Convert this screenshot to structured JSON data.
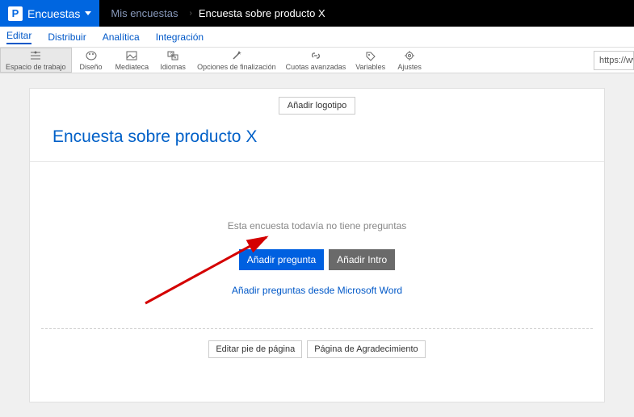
{
  "top": {
    "brand_letter": "P",
    "brand_label": "Encuestas",
    "my_surveys": "Mis encuestas",
    "breadcrumb_current": "Encuesta sobre producto X"
  },
  "subnav": {
    "edit": "Editar",
    "distribute": "Distribuir",
    "analytics": "Analítica",
    "integration": "Integración"
  },
  "toolbar": {
    "workspace": "Espacio de trabajo",
    "design": "Diseño",
    "media": "Mediateca",
    "languages": "Idiomas",
    "completion": "Opciones de finalización",
    "quotas": "Cuotas avanzadas",
    "variables": "Variables",
    "settings": "Ajustes",
    "url_prefix": "https://ww"
  },
  "canvas": {
    "add_logo": "Añadir logotipo",
    "survey_title": "Encuesta sobre producto X",
    "empty_msg": "Esta encuesta todavía no tiene preguntas",
    "add_question": "Añadir pregunta",
    "add_intro": "Añadir Intro",
    "add_from_word": "Añadir preguntas desde Microsoft Word",
    "edit_footer": "Editar pie de página",
    "thanks_page": "Página de Agradecimiento"
  }
}
